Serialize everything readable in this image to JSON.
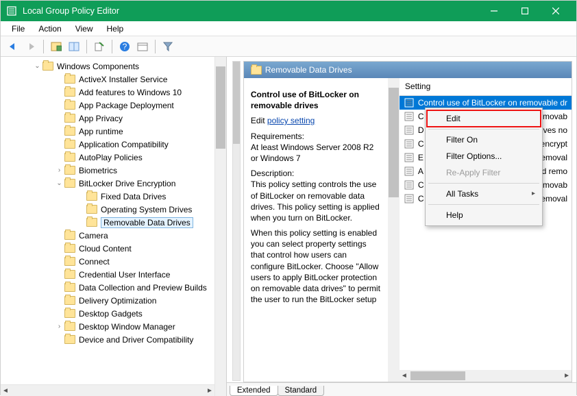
{
  "window": {
    "title": "Local Group Policy Editor"
  },
  "menubar": [
    "File",
    "Action",
    "View",
    "Help"
  ],
  "tree": {
    "root": {
      "label": "Windows Components",
      "expanded": true
    },
    "children": [
      {
        "label": "ActiveX Installer Service"
      },
      {
        "label": "Add features to Windows 10"
      },
      {
        "label": "App Package Deployment"
      },
      {
        "label": "App Privacy"
      },
      {
        "label": "App runtime"
      },
      {
        "label": "Application Compatibility"
      },
      {
        "label": "AutoPlay Policies"
      },
      {
        "label": "Biometrics",
        "toggle": ">"
      },
      {
        "label": "BitLocker Drive Encryption",
        "toggle": "v",
        "children": [
          {
            "label": "Fixed Data Drives"
          },
          {
            "label": "Operating System Drives"
          },
          {
            "label": "Removable Data Drives",
            "selected": true
          }
        ]
      },
      {
        "label": "Camera"
      },
      {
        "label": "Cloud Content"
      },
      {
        "label": "Connect"
      },
      {
        "label": "Credential User Interface"
      },
      {
        "label": "Data Collection and Preview Builds"
      },
      {
        "label": "Delivery Optimization"
      },
      {
        "label": "Desktop Gadgets"
      },
      {
        "label": "Desktop Window Manager",
        "toggle": ">"
      },
      {
        "label": "Device and Driver Compatibility"
      }
    ]
  },
  "right": {
    "header": "Removable Data Drives",
    "policy_title": "Control use of BitLocker on removable drives",
    "edit_label": "Edit",
    "edit_link": "policy setting ",
    "req_label": "Requirements:",
    "req_text": "At least Windows Server 2008 R2 or Windows 7",
    "desc_label": "Description:",
    "desc_text": "This policy setting controls the use of BitLocker on removable data drives. This policy setting is applied when you turn on BitLocker.",
    "desc_text2": "When this policy setting is enabled you can select property settings that control how users can configure BitLocker. Choose \"Allow users to apply BitLocker protection on removable data drives\" to permit the user to run the BitLocker setup"
  },
  "settings": {
    "column": "Setting",
    "rows": [
      {
        "label": "Control use of BitLocker on removable dr",
        "sel": true
      },
      {
        "label": "C",
        "tail": "emovab"
      },
      {
        "label": "D",
        "tail": "rives no"
      },
      {
        "label": "C",
        "tail": "encrypt"
      },
      {
        "label": "E",
        "tail": "emoval"
      },
      {
        "label": "A",
        "tail": "ed remo"
      },
      {
        "label": "C",
        "tail": "emovab"
      },
      {
        "label": "C",
        "tail": "emoval"
      }
    ]
  },
  "context_menu": [
    {
      "label": "Edit",
      "boxed": true
    },
    {
      "sep": true
    },
    {
      "label": "Filter On"
    },
    {
      "label": "Filter Options..."
    },
    {
      "label": "Re-Apply Filter",
      "disabled": true
    },
    {
      "sep": true
    },
    {
      "label": "All Tasks",
      "sub": true
    },
    {
      "sep": true
    },
    {
      "label": "Help"
    }
  ],
  "tabs": {
    "extended": "Extended",
    "standard": "Standard"
  }
}
